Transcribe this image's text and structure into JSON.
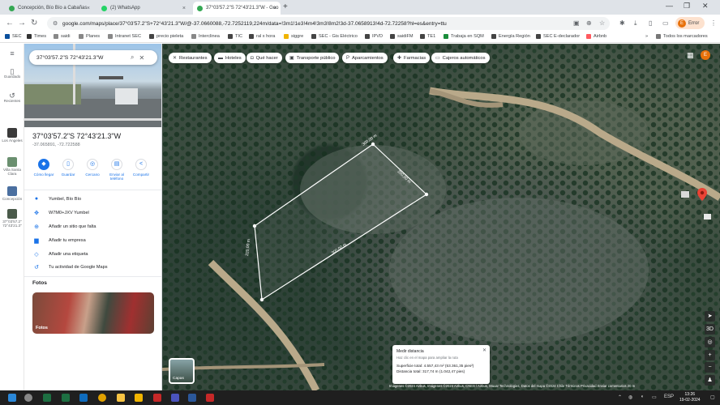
{
  "browser": {
    "tabs": [
      {
        "title": "Concepción, Bío Bío a Cabañas",
        "fav_color": "#34a853"
      },
      {
        "title": "(2) WhatsApp",
        "fav_color": "#25d366"
      },
      {
        "title": "37°03'57.2\"S 72°43'21.3\"W - Goo",
        "fav_color": "#34a853"
      }
    ],
    "url": "google.com/maps/place/37°03'57.2\"S+72°43'21.3\"W/@-37.0660088,-72.7252119,224m/data=!3m1!1e3!4m4!3m3!8m2!3d-37.0658913!4d-72.72258?hl=es&entry=ttu",
    "profile_label": "Error",
    "profile_initial": "E",
    "bookmarks": [
      {
        "label": "SEC",
        "color": "#0b4f9c"
      },
      {
        "label": "Times",
        "color": "#333"
      },
      {
        "label": "saidi",
        "color": "#888"
      },
      {
        "label": "Planes",
        "color": "#888"
      },
      {
        "label": "Intranet SEC",
        "color": "#888"
      },
      {
        "label": "precio pieleta",
        "color": "#444"
      },
      {
        "label": "Interclinea",
        "color": "#888"
      },
      {
        "label": "TIC",
        "color": "#444"
      },
      {
        "label": "ral x hora",
        "color": "#444"
      },
      {
        "label": "siggre",
        "color": "#f0b400"
      },
      {
        "label": "SEC - Gis Eléctrico",
        "color": "#444"
      },
      {
        "label": "IPVD",
        "color": "#444"
      },
      {
        "label": "saidiFM",
        "color": "#444"
      },
      {
        "label": "TE1",
        "color": "#444"
      },
      {
        "label": "Trabaja en SQM",
        "color": "#1a8d3b"
      },
      {
        "label": "Energía Región",
        "color": "#444"
      },
      {
        "label": "SEC E-declarador",
        "color": "#444"
      },
      {
        "label": "Airbnb",
        "color": "#ff5a5f"
      }
    ],
    "bookmarks_more": "»",
    "all_bookmarks": "Todos los marcadores"
  },
  "rail": {
    "items": [
      {
        "label": "Guardado",
        "icon": "bookmark-icon"
      },
      {
        "label": "Recientes",
        "icon": "history-icon"
      }
    ],
    "recent": [
      {
        "label": "Los Ángeles",
        "color": "#3a3a3a"
      },
      {
        "label": "Villa Santa Clara",
        "color": "#6a8f6f"
      },
      {
        "label": "Concepción",
        "color": "#4a6fa0"
      },
      {
        "label": "37°03'57.2\" 72°43'21.3\"",
        "color": "#4a5a4a"
      }
    ]
  },
  "panel": {
    "search_value": "37°03'57.2\"S 72°43'21.3\"W",
    "title": "37°03'57.2\"S 72°43'21.3\"W",
    "coords": "-37.065891, -72.722588",
    "actions": [
      {
        "label": "Cómo llegar",
        "icon": "directions-icon",
        "glyph": "◆"
      },
      {
        "label": "Guardar",
        "icon": "bookmark-icon",
        "glyph": "▯"
      },
      {
        "label": "Cercano",
        "icon": "nearby-icon",
        "glyph": "◎"
      },
      {
        "label": "Enviar al teléfono",
        "icon": "send-to-phone-icon",
        "glyph": "▤"
      },
      {
        "label": "Compartir",
        "icon": "share-icon",
        "glyph": "<"
      }
    ],
    "info": [
      {
        "label": "Yumbel, Bío Bío",
        "icon": "location-pin-icon",
        "glyph": "●"
      },
      {
        "label": "W7M0+JXV Yumbel",
        "icon": "plus-code-icon",
        "glyph": "✥"
      },
      {
        "label": "Añadir un sitio que falta",
        "icon": "add-place-icon",
        "glyph": "⊕"
      },
      {
        "label": "Añadir tu empresa",
        "icon": "business-icon",
        "glyph": "▆"
      },
      {
        "label": "Añadir una etiqueta",
        "icon": "label-icon",
        "glyph": "◇"
      },
      {
        "label": "Tu actividad de Google Maps",
        "icon": "activity-icon",
        "glyph": "↺"
      }
    ],
    "photos_title": "Fotos",
    "photos_label": "Fotos"
  },
  "map": {
    "chips": [
      {
        "label": "Restaurantes",
        "icon": "restaurant-icon",
        "glyph": "🍴"
      },
      {
        "label": "Hoteles",
        "icon": "hotel-icon",
        "glyph": "▬"
      },
      {
        "label": "Qué hacer",
        "icon": "camera-icon",
        "glyph": "◘"
      },
      {
        "label": "Transporte público",
        "icon": "transit-icon",
        "glyph": "▣"
      },
      {
        "label": "Aparcamientos",
        "icon": "parking-icon",
        "glyph": "P"
      },
      {
        "label": "Farmacias",
        "icon": "pharmacy-icon",
        "glyph": "✚"
      },
      {
        "label": "Cajeros automáticos",
        "icon": "atm-icon",
        "glyph": "▭"
      }
    ],
    "layers_label": "Capas",
    "segments": [
      "300,00 m",
      "200,00 m",
      "300,00 m",
      "220,00 m"
    ],
    "measure": {
      "title": "Medir distancia",
      "hint": "Haz clic en el mapa para ampliar la ruta",
      "area": "Superficie total: 4.557,43 m² (53.361,35 pies²)",
      "distance": "Distancia total: 317,74 m (1.042,47 pies)"
    },
    "attribution": "Imágenes ©2024 Airbus, Imágenes ©2024 Airbus, CNES / Airbus, Maxar Technologies, Datos del mapa ©2024   Chile   Términos   Privacidad   Enviar comentarios   20 m"
  },
  "taskbar": {
    "time": "13:26",
    "date": "19-02-2024",
    "lang": "ESP",
    "apps": [
      {
        "name": "start",
        "color": "#2b88d8"
      },
      {
        "name": "search",
        "color": "#888"
      },
      {
        "name": "excel",
        "color": "#1d6f42"
      },
      {
        "name": "excel-2",
        "color": "#1d6f42"
      },
      {
        "name": "outlook",
        "color": "#0f6cbd"
      },
      {
        "name": "chrome",
        "color": "#e0a100"
      },
      {
        "name": "files",
        "color": "#f6c343"
      },
      {
        "name": "onedrive",
        "color": "#f0b400"
      },
      {
        "name": "red-app",
        "color": "#c62828"
      },
      {
        "name": "teams",
        "color": "#4b53bc"
      },
      {
        "name": "word",
        "color": "#2b579a"
      },
      {
        "name": "pdf",
        "color": "#c62828"
      }
    ]
  }
}
